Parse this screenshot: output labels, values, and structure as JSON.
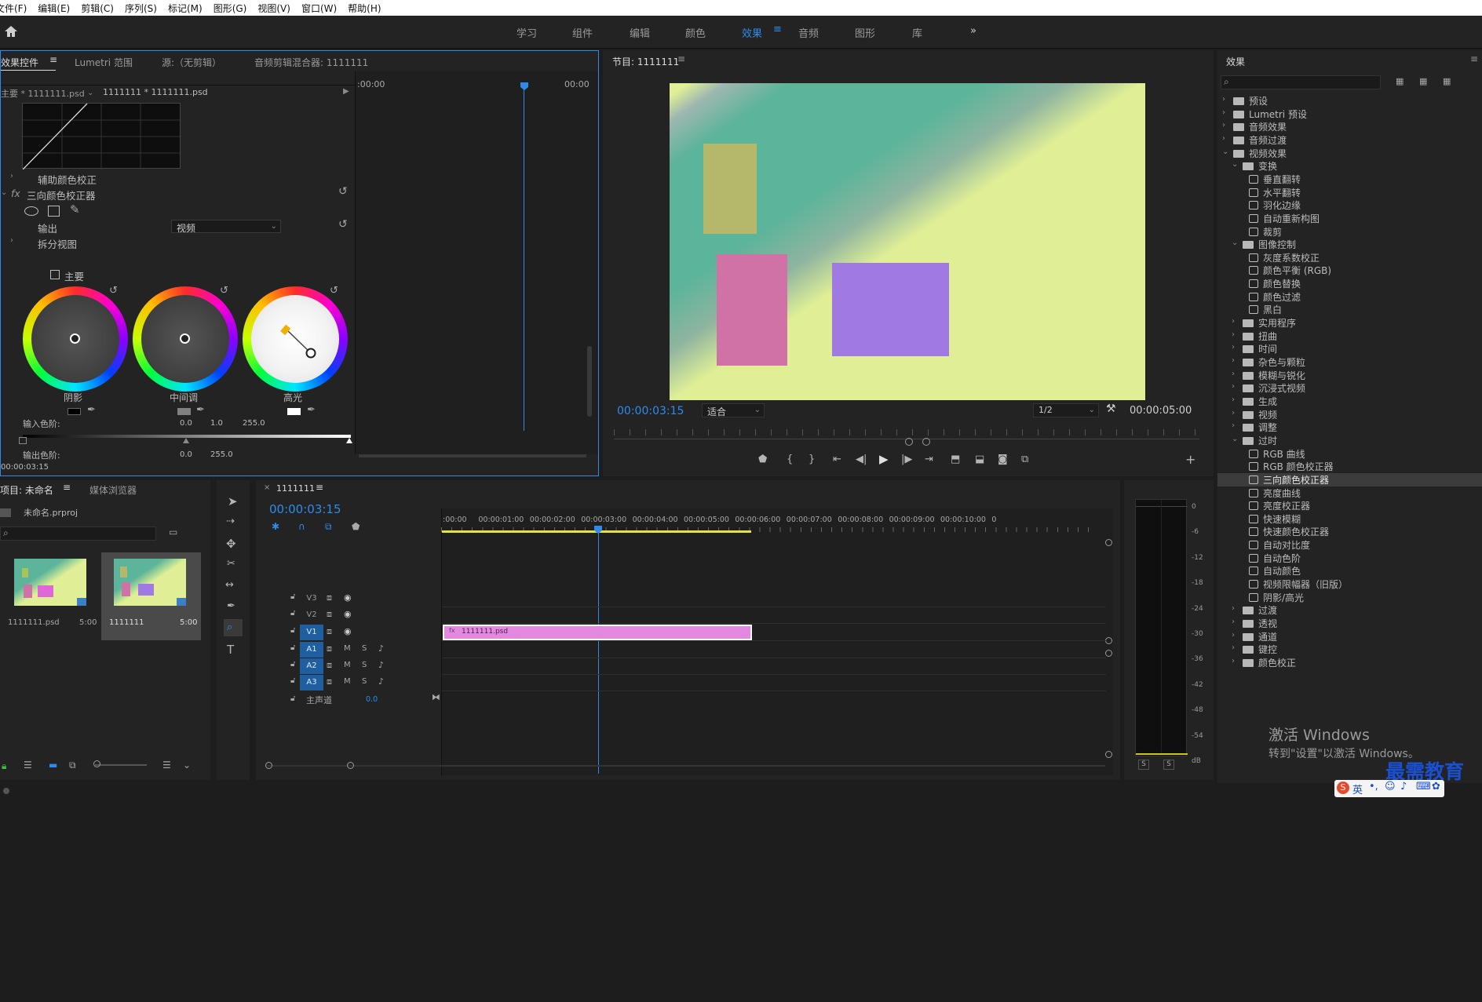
{
  "menu": [
    "文件(F)",
    "编辑(E)",
    "剪辑(C)",
    "序列(S)",
    "标记(M)",
    "图形(G)",
    "视图(V)",
    "窗口(W)",
    "帮助(H)"
  ],
  "workspaces": {
    "items": [
      "学习",
      "组件",
      "编辑",
      "颜色",
      "效果",
      "音频",
      "图形",
      "库"
    ],
    "active": "效果",
    "more": "»"
  },
  "effect_controls": {
    "tabs": [
      "效果控件",
      "Lumetri 范围",
      "源:（无剪辑）",
      "音频剪辑混合器: 1111111"
    ],
    "master": "主要 * 1111111.psd",
    "clip": "1111111 * 1111111.psd",
    "time_start": ":00:00",
    "time_end": "00:00",
    "aux": "辅助颜色校正",
    "fx_label": "fx",
    "fx_name": "三向颜色校正器",
    "output_label": "输出",
    "output_value": "视频",
    "split": "拆分视图",
    "master_check": "主要",
    "wheels": [
      "阴影",
      "中间调",
      "高光"
    ],
    "input_levels": "输入色阶:",
    "in_vals": [
      "0.0",
      "1.0",
      "255.0"
    ],
    "output_levels": "输出色阶:",
    "out_vals": [
      "0.0",
      "255.0"
    ],
    "timecode": "00:00:03:15"
  },
  "program": {
    "title": "节目: 1111111",
    "timecode": "00:00:03:15",
    "fit": "适合",
    "quality": "1/2",
    "duration": "00:00:05:00",
    "colors": {
      "green": "#5cb49a",
      "yellow": "#e0ef96",
      "olive": "#b5b86a",
      "pink": "#d072a6",
      "purple": "#a07ae2"
    }
  },
  "project": {
    "tabs": [
      "项目: 未命名",
      "媒体浏览器"
    ],
    "file": "未命名.prproj",
    "items": [
      {
        "name": "1111111.psd",
        "dur": "5:00"
      },
      {
        "name": "1111111",
        "dur": "5:00"
      }
    ]
  },
  "timeline": {
    "tab": "1111111",
    "timecode": "00:00:03:15",
    "ruler": [
      ":00:00",
      "00:00:01:00",
      "00:00:02:00",
      "00:00:03:00",
      "00:00:04:00",
      "00:00:05:00",
      "00:00:06:00",
      "00:00:07:00",
      "00:00:08:00",
      "00:00:09:00",
      "00:00:10:00",
      "0"
    ],
    "tracks": [
      "V3",
      "V2",
      "V1",
      "A1",
      "A2",
      "A3"
    ],
    "master": "主声道",
    "master_val": "0.0",
    "clip": "1111111.psd",
    "m": "M",
    "s": "S"
  },
  "meter": {
    "scale": [
      "0",
      "-6",
      "-12",
      "-18",
      "-24",
      "-30",
      "-36",
      "-42",
      "-48",
      "-54",
      "dB"
    ],
    "s": "S"
  },
  "effects": {
    "title": "效果",
    "tree": [
      {
        "l": 0,
        "t": "f",
        "c": "c",
        "n": "预设"
      },
      {
        "l": 0,
        "t": "f",
        "c": "c",
        "n": "Lumetri 预设"
      },
      {
        "l": 0,
        "t": "f",
        "c": "c",
        "n": "音频效果"
      },
      {
        "l": 0,
        "t": "f",
        "c": "c",
        "n": "音频过渡"
      },
      {
        "l": 0,
        "t": "f",
        "c": "o",
        "n": "视频效果"
      },
      {
        "l": 1,
        "t": "f",
        "c": "o",
        "n": "变换"
      },
      {
        "l": 2,
        "t": "e",
        "n": "垂直翻转"
      },
      {
        "l": 2,
        "t": "e",
        "n": "水平翻转"
      },
      {
        "l": 2,
        "t": "e",
        "n": "羽化边缘"
      },
      {
        "l": 2,
        "t": "e",
        "n": "自动重新构图"
      },
      {
        "l": 2,
        "t": "e",
        "n": "裁剪"
      },
      {
        "l": 1,
        "t": "f",
        "c": "o",
        "n": "图像控制"
      },
      {
        "l": 2,
        "t": "e",
        "n": "灰度系数校正"
      },
      {
        "l": 2,
        "t": "e",
        "n": "颜色平衡 (RGB)"
      },
      {
        "l": 2,
        "t": "e",
        "n": "颜色替换"
      },
      {
        "l": 2,
        "t": "e",
        "n": "颜色过滤"
      },
      {
        "l": 2,
        "t": "e",
        "n": "黑白"
      },
      {
        "l": 1,
        "t": "f",
        "c": "c",
        "n": "实用程序"
      },
      {
        "l": 1,
        "t": "f",
        "c": "c",
        "n": "扭曲"
      },
      {
        "l": 1,
        "t": "f",
        "c": "c",
        "n": "时间"
      },
      {
        "l": 1,
        "t": "f",
        "c": "c",
        "n": "杂色与颗粒"
      },
      {
        "l": 1,
        "t": "f",
        "c": "c",
        "n": "模糊与锐化"
      },
      {
        "l": 1,
        "t": "f",
        "c": "c",
        "n": "沉浸式视频"
      },
      {
        "l": 1,
        "t": "f",
        "c": "c",
        "n": "生成"
      },
      {
        "l": 1,
        "t": "f",
        "c": "c",
        "n": "视频"
      },
      {
        "l": 1,
        "t": "f",
        "c": "c",
        "n": "调整"
      },
      {
        "l": 1,
        "t": "f",
        "c": "o",
        "n": "过时"
      },
      {
        "l": 2,
        "t": "e",
        "n": "RGB 曲线"
      },
      {
        "l": 2,
        "t": "e",
        "n": "RGB 颜色校正器"
      },
      {
        "l": 2,
        "t": "e",
        "n": "三向颜色校正器",
        "sel": true
      },
      {
        "l": 2,
        "t": "e",
        "n": "亮度曲线"
      },
      {
        "l": 2,
        "t": "e",
        "n": "亮度校正器"
      },
      {
        "l": 2,
        "t": "e",
        "n": "快速模糊"
      },
      {
        "l": 2,
        "t": "e",
        "n": "快速颜色校正器"
      },
      {
        "l": 2,
        "t": "e",
        "n": "自动对比度"
      },
      {
        "l": 2,
        "t": "e",
        "n": "自动色阶"
      },
      {
        "l": 2,
        "t": "e",
        "n": "自动颜色"
      },
      {
        "l": 2,
        "t": "e",
        "n": "视频限幅器（旧版）"
      },
      {
        "l": 2,
        "t": "e",
        "n": "阴影/高光"
      },
      {
        "l": 1,
        "t": "f",
        "c": "c",
        "n": "过渡"
      },
      {
        "l": 1,
        "t": "f",
        "c": "c",
        "n": "透视"
      },
      {
        "l": 1,
        "t": "f",
        "c": "c",
        "n": "通道"
      },
      {
        "l": 1,
        "t": "f",
        "c": "c",
        "n": "键控"
      },
      {
        "l": 1,
        "t": "f",
        "c": "c",
        "n": "颜色校正"
      }
    ]
  },
  "watermark": {
    "line1": "激活 Windows",
    "line2": "转到\"设置\"以激活 Windows。",
    "brand": "最需教育",
    "ime": "英"
  }
}
